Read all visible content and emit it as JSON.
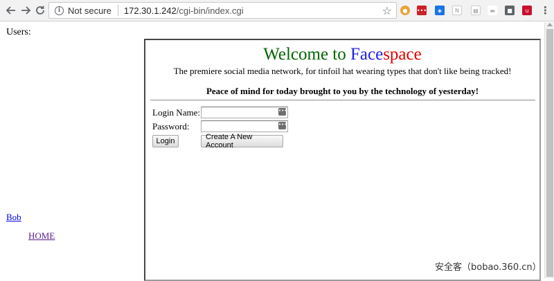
{
  "browser": {
    "security_label": "Not secure",
    "url_host": "172.30.1.242",
    "url_path": "/cgi-bin/index.cgi",
    "icons": {
      "back": "back-arrow-icon",
      "forward": "forward-arrow-icon",
      "reload": "reload-icon",
      "info": "info-icon",
      "bookmark": "star-icon",
      "menu": "kebab-menu-icon"
    },
    "extensions": [
      {
        "name": "cookie-extension-icon",
        "glyph": "🍪",
        "color": "#e8a33c"
      },
      {
        "name": "lastpass-extension-icon",
        "glyph": "•••",
        "color": "#cc2127"
      },
      {
        "name": "blue-extension-icon",
        "glyph": "◈",
        "color": "#1a73e8"
      },
      {
        "name": "n-extension-icon",
        "glyph": "N",
        "color": "#bbbbbb"
      },
      {
        "name": "document-extension-icon",
        "glyph": "▤",
        "color": "#9e9e9e"
      },
      {
        "name": "dash-extension-icon",
        "glyph": "▬",
        "color": "#b5b5b5"
      },
      {
        "name": "square-extension-icon",
        "glyph": "■",
        "color": "#5f6368"
      },
      {
        "name": "ublock-extension-icon",
        "glyph": "u",
        "color": "#c8102e"
      }
    ]
  },
  "page": {
    "users_label": "Users:",
    "users": [
      {
        "label": "Bob"
      }
    ],
    "home_link": "HOME",
    "welcome": {
      "prefix": "Welcome to ",
      "face": "Face",
      "space": "space"
    },
    "tagline": "The premiere social media network, for tinfoil hat wearing types that don't like being tracked!",
    "peace": "Peace of mind for today brought to you by the technology of yesterday!",
    "form": {
      "login_label": "Login Name:",
      "password_label": "Password:",
      "login_value": "",
      "password_value": "",
      "login_button": "Login",
      "create_button": "Create A New Account"
    },
    "colors": {
      "welcome": "#006400",
      "face": "#2020dd",
      "space": "#e00000"
    }
  },
  "watermark": "安全客（bobao.360.cn）"
}
